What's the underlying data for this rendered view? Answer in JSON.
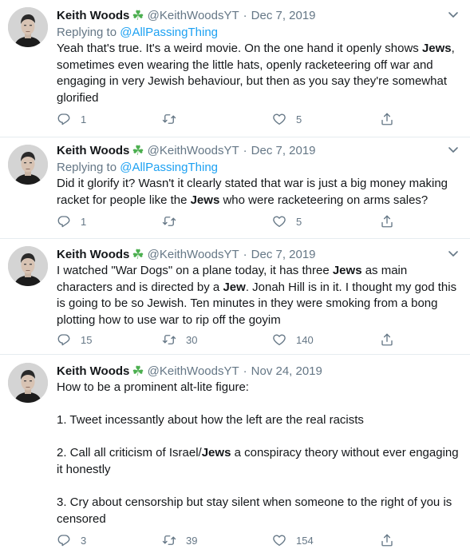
{
  "user": {
    "name": "Keith Woods",
    "emoji": "☘",
    "handle": "@KeithWoodsYT"
  },
  "tweets": [
    {
      "date": "Dec 7, 2019",
      "replying_prefix": "Replying to ",
      "replying_to": "@AllPassingThing",
      "segments": [
        {
          "t": "Yeah that's true. It's a weird movie. On the one hand it openly shows "
        },
        {
          "t": "Jews",
          "b": true
        },
        {
          "t": ", sometimes even wearing the little hats, openly racketeering off war and engaging in very Jewish behaviour, but then as you say they're somewhat glorified"
        }
      ],
      "replies": "1",
      "retweets": "",
      "likes": "5"
    },
    {
      "date": "Dec 7, 2019",
      "replying_prefix": "Replying to ",
      "replying_to": "@AllPassingThing",
      "segments": [
        {
          "t": "Did it glorify it? Wasn't it clearly stated that war is just a big money making racket for people like the "
        },
        {
          "t": "Jews",
          "b": true
        },
        {
          "t": " who were racketeering on arms sales?"
        }
      ],
      "replies": "1",
      "retweets": "",
      "likes": "5"
    },
    {
      "date": "Dec 7, 2019",
      "replying_prefix": "",
      "replying_to": "",
      "segments": [
        {
          "t": "I watched \"War Dogs\" on a plane today, it has three "
        },
        {
          "t": "Jews",
          "b": true
        },
        {
          "t": " as main characters and is directed by a "
        },
        {
          "t": "Jew",
          "b": true
        },
        {
          "t": ". Jonah Hill is in it. I thought my god this is going to be so Jewish. Ten minutes in they were smoking from a bong plotting how to use war to rip off the goyim"
        }
      ],
      "replies": "15",
      "retweets": "30",
      "likes": "140"
    },
    {
      "date": "Nov 24, 2019",
      "replying_prefix": "",
      "replying_to": "",
      "paragraphs": [
        [
          {
            "t": "How to be a prominent alt-lite figure:"
          }
        ],
        [
          {
            "t": "1. Tweet incessantly about how the left are the real racists"
          }
        ],
        [
          {
            "t": "2. Call all criticism of Israel/"
          },
          {
            "t": "Jews",
            "b": true
          },
          {
            "t": " a conspiracy theory without ever engaging it honestly"
          }
        ],
        [
          {
            "t": "3. Cry about censorship but stay silent when someone to the right of you is censored"
          }
        ]
      ],
      "replies": "3",
      "retweets": "39",
      "likes": "154"
    }
  ]
}
